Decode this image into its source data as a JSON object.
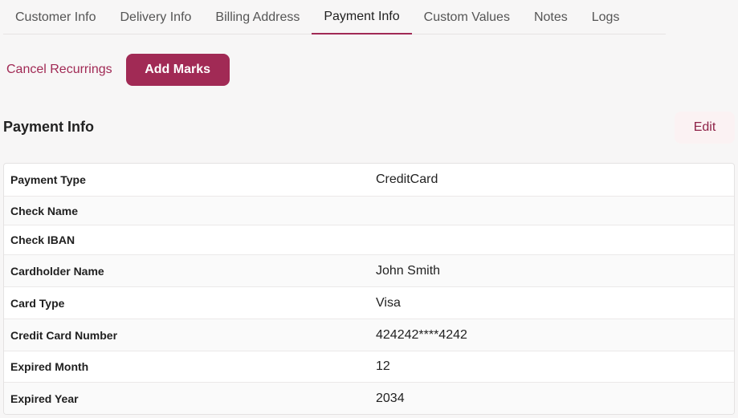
{
  "tabs": [
    {
      "label": "Customer Info",
      "active": false
    },
    {
      "label": "Delivery Info",
      "active": false
    },
    {
      "label": "Billing Address",
      "active": false
    },
    {
      "label": "Payment Info",
      "active": true
    },
    {
      "label": "Custom Values",
      "active": false
    },
    {
      "label": "Notes",
      "active": false
    },
    {
      "label": "Logs",
      "active": false
    }
  ],
  "actions": {
    "cancel_label": "Cancel Recurrings",
    "add_marks_label": "Add Marks"
  },
  "section": {
    "title": "Payment Info",
    "edit_label": "Edit"
  },
  "rows": [
    {
      "label": "Payment Type",
      "value": "CreditCard"
    },
    {
      "label": "Check Name",
      "value": ""
    },
    {
      "label": "Check IBAN",
      "value": ""
    },
    {
      "label": "Cardholder Name",
      "value": "John Smith"
    },
    {
      "label": "Card Type",
      "value": "Visa"
    },
    {
      "label": "Credit Card Number",
      "value": "424242****4242"
    },
    {
      "label": "Expired Month",
      "value": "12"
    },
    {
      "label": "Expired Year",
      "value": "2034"
    }
  ],
  "colors": {
    "accent": "#a12a55",
    "edit_bg": "#fbf2f3"
  }
}
